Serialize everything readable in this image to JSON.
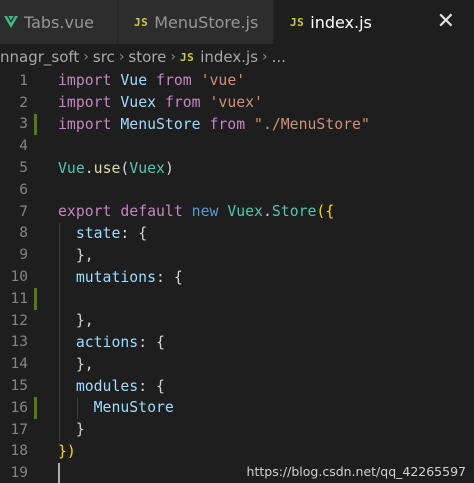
{
  "tabs": [
    {
      "label": "Tabs.vue",
      "icon": "vue-icon"
    },
    {
      "label": "MenuStore.js",
      "icon": "js-icon",
      "badge": "JS"
    },
    {
      "label": "index.js",
      "icon": "js-icon",
      "badge": "JS",
      "active": true,
      "close": "✕"
    }
  ],
  "breadcrumb": {
    "items": [
      "nnagr_soft",
      "src",
      "store",
      "index.js",
      "..."
    ],
    "file_badge": "JS"
  },
  "code_lines": [
    {
      "n": "1",
      "modified": false,
      "tokens": [
        [
          "kw",
          "import"
        ],
        [
          "pun",
          " "
        ],
        [
          "var",
          "Vue"
        ],
        [
          "pun",
          " "
        ],
        [
          "kw",
          "from"
        ],
        [
          "pun",
          " "
        ],
        [
          "str",
          "'vue'"
        ]
      ]
    },
    {
      "n": "2",
      "modified": false,
      "tokens": [
        [
          "kw",
          "import"
        ],
        [
          "pun",
          " "
        ],
        [
          "var",
          "Vuex"
        ],
        [
          "pun",
          " "
        ],
        [
          "kw",
          "from"
        ],
        [
          "pun",
          " "
        ],
        [
          "str",
          "'vuex'"
        ]
      ]
    },
    {
      "n": "3",
      "modified": true,
      "tokens": [
        [
          "kw",
          "import"
        ],
        [
          "pun",
          " "
        ],
        [
          "var",
          "MenuStore"
        ],
        [
          "pun",
          " "
        ],
        [
          "kw",
          "from"
        ],
        [
          "pun",
          " "
        ],
        [
          "str",
          "\"./MenuStore\""
        ]
      ]
    },
    {
      "n": "4",
      "modified": false,
      "tokens": []
    },
    {
      "n": "5",
      "modified": false,
      "tokens": [
        [
          "cls",
          "Vue"
        ],
        [
          "pun",
          "."
        ],
        [
          "fn",
          "use"
        ],
        [
          "pun",
          "("
        ],
        [
          "cls",
          "Vuex"
        ],
        [
          "pun",
          ")"
        ]
      ]
    },
    {
      "n": "6",
      "modified": false,
      "tokens": []
    },
    {
      "n": "7",
      "modified": false,
      "tokens": [
        [
          "kw",
          "export"
        ],
        [
          "pun",
          " "
        ],
        [
          "kw",
          "default"
        ],
        [
          "pun",
          " "
        ],
        [
          "kw2",
          "new"
        ],
        [
          "pun",
          " "
        ],
        [
          "cls",
          "Vuex"
        ],
        [
          "pun",
          "."
        ],
        [
          "cls",
          "Store"
        ],
        [
          "brk",
          "({"
        ]
      ]
    },
    {
      "n": "8",
      "modified": false,
      "tokens": [
        [
          "pun",
          "  "
        ],
        [
          "var",
          "state"
        ],
        [
          "pun",
          ": {"
        ]
      ]
    },
    {
      "n": "9",
      "modified": false,
      "tokens": [
        [
          "pun",
          "  },"
        ]
      ]
    },
    {
      "n": "10",
      "modified": false,
      "tokens": [
        [
          "pun",
          "  "
        ],
        [
          "var",
          "mutations"
        ],
        [
          "pun",
          ": {"
        ]
      ]
    },
    {
      "n": "11",
      "modified": true,
      "tokens": []
    },
    {
      "n": "12",
      "modified": false,
      "tokens": [
        [
          "pun",
          "  },"
        ]
      ]
    },
    {
      "n": "13",
      "modified": false,
      "tokens": [
        [
          "pun",
          "  "
        ],
        [
          "var",
          "actions"
        ],
        [
          "pun",
          ": {"
        ]
      ]
    },
    {
      "n": "14",
      "modified": false,
      "tokens": [
        [
          "pun",
          "  },"
        ]
      ]
    },
    {
      "n": "15",
      "modified": false,
      "tokens": [
        [
          "pun",
          "  "
        ],
        [
          "var",
          "modules"
        ],
        [
          "pun",
          ": {"
        ]
      ]
    },
    {
      "n": "16",
      "modified": true,
      "tokens": [
        [
          "pun",
          "    "
        ],
        [
          "var",
          "MenuStore"
        ]
      ]
    },
    {
      "n": "17",
      "modified": false,
      "tokens": [
        [
          "pun",
          "  }"
        ]
      ]
    },
    {
      "n": "18",
      "modified": false,
      "tokens": [
        [
          "brk",
          "})"
        ]
      ]
    },
    {
      "n": "19",
      "modified": false,
      "tokens": []
    }
  ],
  "watermark": "https://blog.csdn.net/qq_42265597",
  "colors": {
    "editor_bg": "#1e1e1e",
    "keyword": "#c586c0",
    "string": "#ce9178",
    "variable": "#9cdcfe",
    "class": "#4ec9b0",
    "function": "#dcdcaa",
    "modified_gutter": "#587c0c",
    "js_badge": "#cbcb41"
  }
}
